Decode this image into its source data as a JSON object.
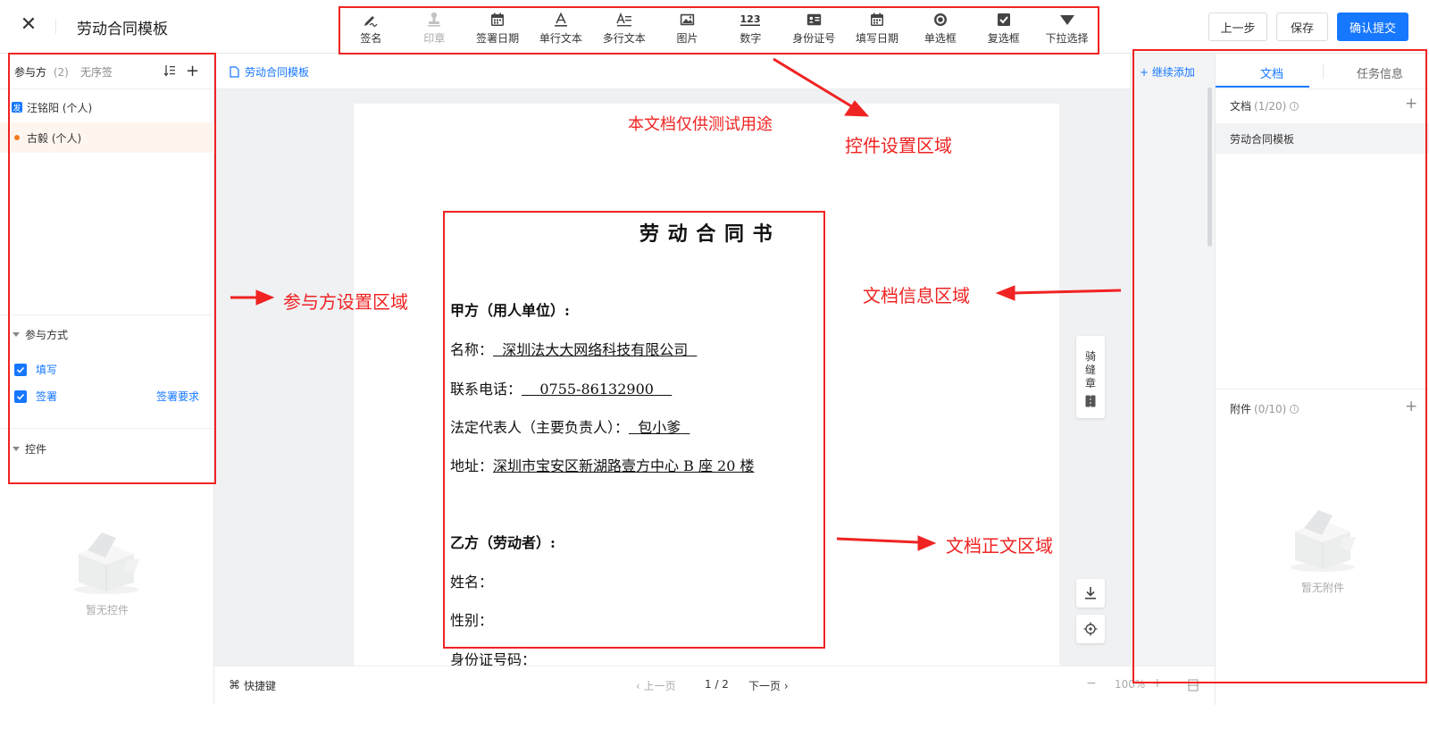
{
  "header": {
    "title": "劳动合同模板",
    "prev_label": "上一步",
    "save_label": "保存",
    "submit_label": "确认提交"
  },
  "toolbar": {
    "items": [
      {
        "label": "签名",
        "icon": "pen-sign-icon"
      },
      {
        "label": "印章",
        "icon": "stamp-icon"
      },
      {
        "label": "签署日期",
        "icon": "calendar-icon"
      },
      {
        "label": "单行文本",
        "icon": "text-a-icon"
      },
      {
        "label": "多行文本",
        "icon": "multiline-text-icon"
      },
      {
        "label": "图片",
        "icon": "image-icon"
      },
      {
        "label": "数字",
        "icon": "number-icon"
      },
      {
        "label": "身份证号",
        "icon": "id-card-icon"
      },
      {
        "label": "填写日期",
        "icon": "calendar-icon"
      },
      {
        "label": "单选框",
        "icon": "radio-icon"
      },
      {
        "label": "复选框",
        "icon": "checkbox-icon"
      },
      {
        "label": "下拉选择",
        "icon": "dropdown-icon"
      }
    ]
  },
  "left": {
    "tab_parties": "参与方",
    "parties_count": "(2)",
    "tab_unordered": "无序签",
    "parties": [
      {
        "badge": "发",
        "name": "汪铭阳 (个人)"
      },
      {
        "name": "古毅 (个人)"
      }
    ],
    "participation_title": "参与方式",
    "fill_label": "填写",
    "sign_label": "签署",
    "sign_req_label": "签署要求",
    "controls_title": "控件",
    "empty_controls": "暂无控件"
  },
  "center": {
    "doc_tab": "劳动合同模板",
    "test_notice": "本文档仅供测试用途",
    "doc_title": "劳 动 合 同 书",
    "party_a": "甲方（用人单位）:",
    "name_label": "名称：",
    "name_value": "深圳法大大网络科技有限公司",
    "phone_label": "联系电话：",
    "phone_value": "0755-86132900",
    "legal_label": "法定代表人（主要负责人）：",
    "legal_value": "包小爹",
    "addr_label": "地址：",
    "addr_value": "深圳市宝安区新湖路壹方中心 B 座 20 楼",
    "party_b": "乙方（劳动者）:",
    "b_name": "姓名：",
    "b_gender": "性别：",
    "b_id": "身份证号码：",
    "seam_label": "骑缝章",
    "shortcut_label": "快捷键",
    "prev_page": "上一页",
    "page_indicator": "1 / 2",
    "next_page": "下一页",
    "zoom": "100%"
  },
  "right": {
    "continue_add": "+ 继续添加",
    "tab_doc": "文档",
    "tab_task": "任务信息",
    "docs_label": "文档",
    "docs_count": "(1/20)",
    "doc_item": "劳动合同模板",
    "attach_label": "附件",
    "attach_count": "(0/10)",
    "empty_attach": "暂无附件"
  },
  "annotations": {
    "controls_area": "控件设置区域",
    "parties_area": "参与方设置区域",
    "doc_info_area": "文档信息区域",
    "doc_body_area": "文档正文区域"
  },
  "colors": {
    "primary": "#1677ff",
    "annotation": "#f02323",
    "accent_orange": "#f07c22"
  }
}
